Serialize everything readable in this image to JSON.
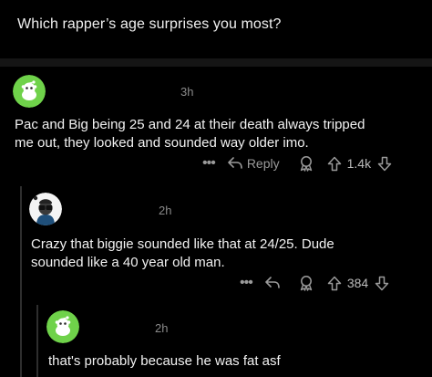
{
  "post": {
    "title": "Which rapper’s age surprises you most?"
  },
  "comments": [
    {
      "avatar_icon": "snoo-avatar-icon",
      "avatar_bg": "#6fd24a",
      "time": "3h",
      "lines": [
        "Pac and Big being 25 and 24 at their death always tripped",
        "me out, they looked and sounded way older imo."
      ],
      "actions": {
        "more": "•••",
        "reply_label": "Reply",
        "score": "1.4k"
      }
    },
    {
      "avatar_icon": "custom-avatar-icon",
      "avatar_bg": "#ffffff",
      "time": "2h",
      "lines": [
        "Crazy that biggie sounded like that at 24/25. Dude",
        "sounded like a 40 year old man."
      ],
      "actions": {
        "more": "•••",
        "score": "384"
      }
    },
    {
      "avatar_icon": "snoo-avatar-icon",
      "avatar_bg": "#6fd24a",
      "time": "2h",
      "lines": [
        "that's probably because he was fat asf"
      ]
    }
  ]
}
